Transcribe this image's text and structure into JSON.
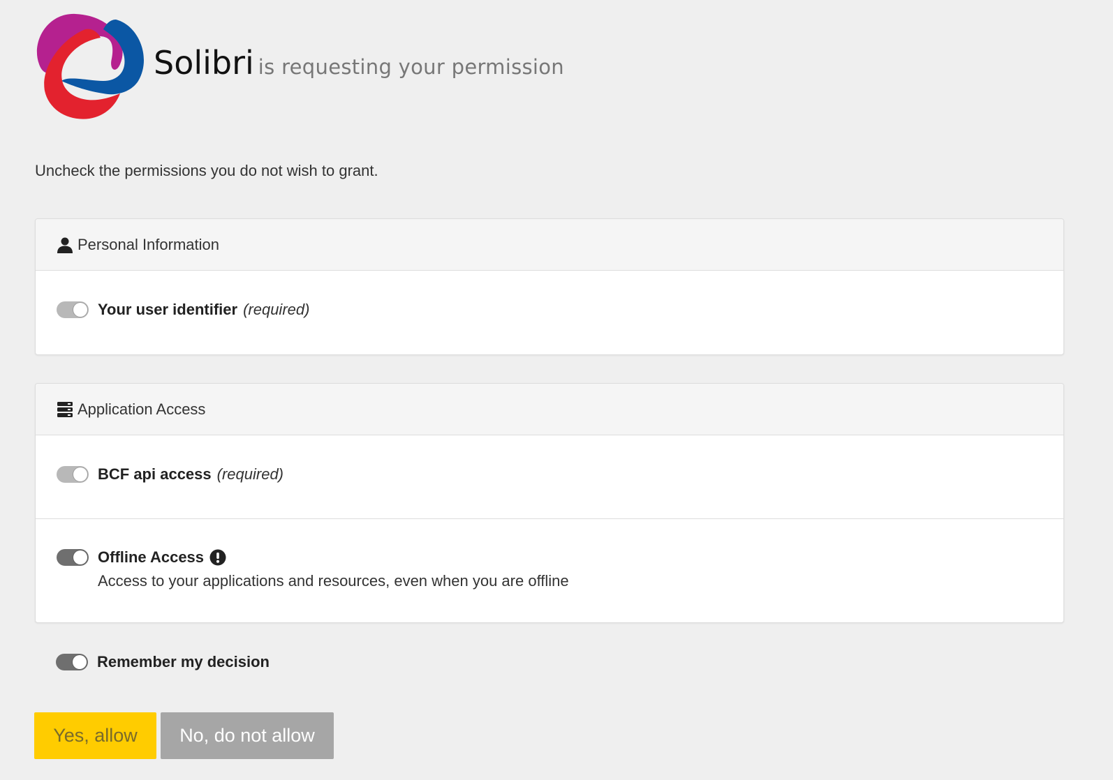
{
  "header": {
    "app_name": "Solibri",
    "subtitle": "is requesting your permission",
    "logo_icon": "solibri-logo"
  },
  "instructions": "Uncheck the permissions you do not wish to grant.",
  "sections": [
    {
      "title": "Personal Information",
      "icon": "user-icon",
      "items": [
        {
          "label": "Your user identifier",
          "note": "(required)",
          "enabled": true,
          "locked": true
        }
      ]
    },
    {
      "title": "Application Access",
      "icon": "server-icon",
      "items": [
        {
          "label": "BCF api access",
          "note": "(required)",
          "enabled": true,
          "locked": true
        },
        {
          "label": "Offline Access",
          "info_icon": "exclamation-icon",
          "description": "Access to your applications and resources, even when you are offline",
          "enabled": true,
          "locked": false
        }
      ]
    }
  ],
  "remember": {
    "label": "Remember my decision",
    "enabled": true
  },
  "buttons": {
    "allow": "Yes, allow",
    "deny": "No, do not allow"
  },
  "colors": {
    "background": "#efefef",
    "allow_button": "#ffcc00",
    "deny_button": "#a6a6a6",
    "toggle_on": "#6f6f6f",
    "toggle_locked": "#b8b8b8",
    "logo_magenta": "#b5218f",
    "logo_blue": "#0b57a4",
    "logo_red": "#e3222e"
  }
}
